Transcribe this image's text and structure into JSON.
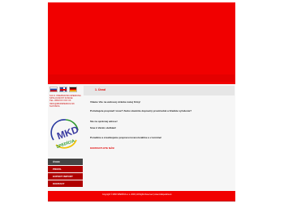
{
  "sidebar": {
    "info_lines": [
      "S.R.O. PREPRAVNO-SPEDIČNÁ",
      "SPOLOČNOSŤ KOŠICE",
      "TEL.:055/XXX XXX XX",
      "INFO@MKDSPEDICIA.SK",
      "SLOVAKIA"
    ],
    "logo_text": "MKD",
    "logo_sub": "SPEDÍCIA",
    "menu": [
      "ÚVOD",
      "PROFIL",
      "EXPORT IMPORT",
      "KONTAKT"
    ]
  },
  "content": {
    "page_title": "1. Úvod",
    "welcome": "Vitame Vás na webovej stránke našej firmy!",
    "line1": "Potrebujete prepraviť tovar?  Alebo vlastníte dopravný prostriedok  a hľadáte vyťaženie?",
    "line2": "Ste na správnej adrese!",
    "line3": "Sme k Vašim službám!",
    "line4": "Poradíme a zrealizujeme prepravu tovaru kvalitne a v termíne!",
    "contact": "KONTAKTUJTE NÁS!"
  },
  "footer": {
    "text": "Copyright © MKD SPEDÍCIA s.r.o. 2009 | All Rights Reserved | www.mkdspedicia.sk"
  },
  "colors": {
    "accent": "#f10000",
    "menu_active": "#444444"
  }
}
